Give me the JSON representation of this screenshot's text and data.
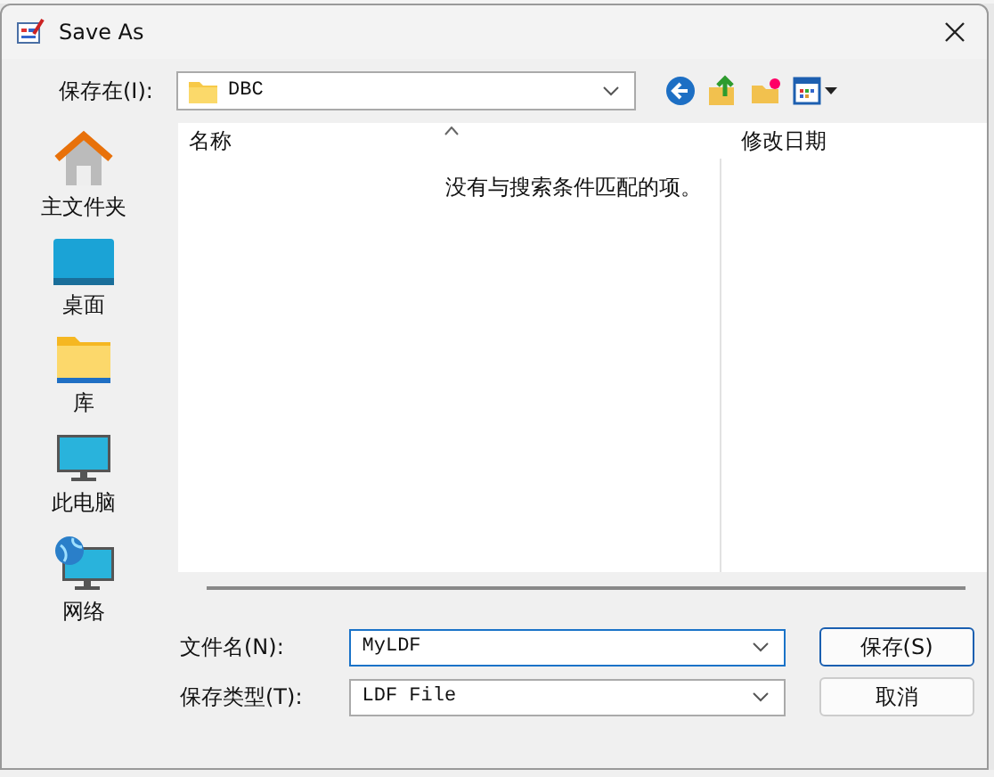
{
  "window": {
    "title": "Save As"
  },
  "location": {
    "label": "保存在(I):",
    "value": "DBC"
  },
  "sidebar": {
    "items": [
      {
        "label": "主文件夹",
        "kind": "home"
      },
      {
        "label": "桌面",
        "kind": "desktop"
      },
      {
        "label": "库",
        "kind": "library"
      },
      {
        "label": "此电脑",
        "kind": "computer"
      },
      {
        "label": "网络",
        "kind": "network"
      }
    ]
  },
  "file_list": {
    "columns": [
      "名称",
      "修改日期"
    ],
    "empty_message": "没有与搜索条件匹配的项。"
  },
  "file_name": {
    "label": "文件名(N):",
    "value": "MyLDF"
  },
  "file_type": {
    "label": "保存类型(T):",
    "value": "LDF File"
  },
  "buttons": [
    {
      "label": "保存(S)",
      "kind": "default"
    },
    {
      "label": "取消",
      "kind": "normal"
    }
  ]
}
